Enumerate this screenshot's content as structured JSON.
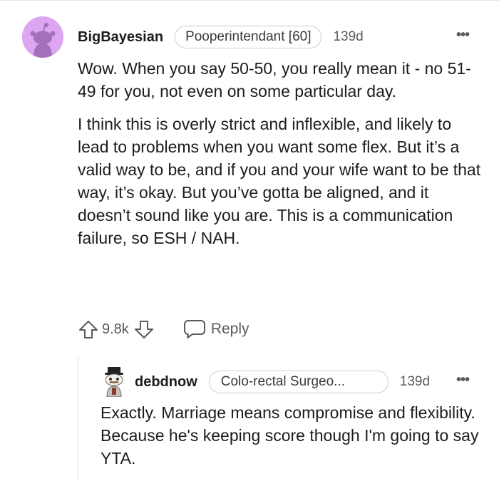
{
  "comment1": {
    "username": "BigBayesian",
    "flair": "Pooperintendant [60]",
    "age": "139d",
    "more": "•••",
    "paragraphs": [
      "Wow. When you say 50-50, you really mean it - no 51-49 for you, not even on some particular day.",
      "I think this is overly strict and inflexible, and likely to lead to problems when you want some flex. But it’s a valid way to be, and if you and your wife want to be that way, it’s okay. But you’ve gotta be aligned, and it doesn’t sound like you are. This is a communication failure, so ESH / NAH."
    ],
    "score": "9.8k",
    "reply_label": "Reply"
  },
  "comment2": {
    "username": "debdnow",
    "flair": "Colo-rectal Surgeo...",
    "age": "139d",
    "more": "•••",
    "body": "Exactly. Marriage means compromise and flexibility. Because he's keeping score though I'm going to say YTA."
  },
  "icons": {
    "upvote": "arrow-up-icon",
    "downvote": "arrow-down-icon",
    "reply": "speech-bubble-icon",
    "more": "ellipsis-icon"
  },
  "colors": {
    "avatar_bg": "#dca6f1",
    "avatar_snoo": "#a470be",
    "text": "#1c1c1c",
    "muted": "#5a5a5a"
  }
}
